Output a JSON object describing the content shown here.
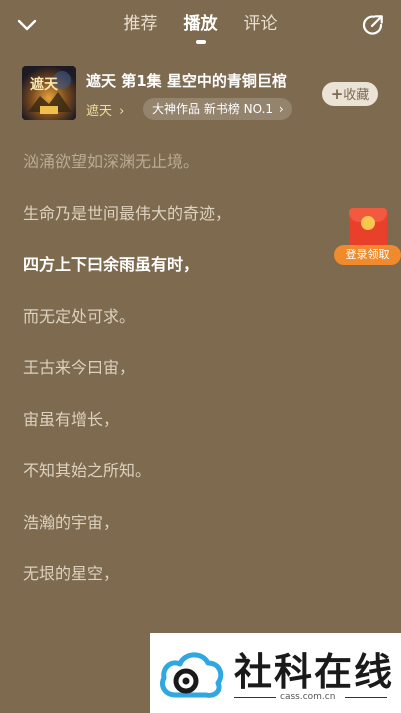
{
  "nav": {
    "tabs": [
      {
        "label": "推荐",
        "active": false
      },
      {
        "label": "播放",
        "active": true
      },
      {
        "label": "评论",
        "active": false
      }
    ],
    "back_icon": "chevron-down-icon",
    "share_icon": "share-icon"
  },
  "book": {
    "title": "遮天 第1集 星空中的青铜巨棺",
    "author": "遮天",
    "badge": "大神作品 新书榜 NO.1",
    "cover_text": "遮天",
    "favorite_label": "收藏"
  },
  "lyrics": [
    {
      "text": "汹涌欲望如深渊无止境。",
      "state": "faded"
    },
    {
      "text": "生命乃是世间最伟大的奇迹，",
      "state": "normal"
    },
    {
      "text": "四方上下曰余雨虽有时，",
      "state": "current"
    },
    {
      "text": "而无定处可求。",
      "state": "normal"
    },
    {
      "text": "王古来今曰宙，",
      "state": "normal"
    },
    {
      "text": "宙虽有增长，",
      "state": "normal"
    },
    {
      "text": "不知其始之所知。",
      "state": "normal"
    },
    {
      "text": "浩瀚的宇宙，",
      "state": "normal"
    },
    {
      "text": "无垠的星空，",
      "state": "normal"
    }
  ],
  "promo": {
    "label": "登录领取"
  },
  "watermark": {
    "text": "社科在线",
    "url": "cass.com.cn"
  },
  "colors": {
    "background": "#7d6a4f",
    "author_gold": "#f2dc9a",
    "promo_red": "#e9402b",
    "promo_orange": "#f08a2c"
  }
}
